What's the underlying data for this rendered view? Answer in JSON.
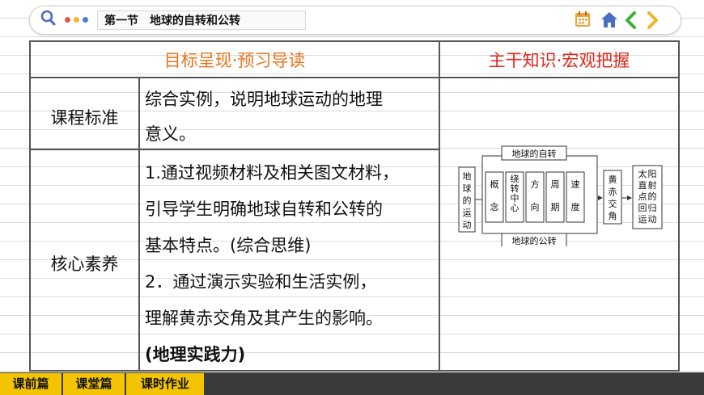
{
  "header": {
    "section_title": "第一节　地球的自转和公转",
    "dot_colors": [
      "#e05a47",
      "#f2b732",
      "#4a7fd6"
    ],
    "icons": [
      "calendar-icon",
      "home-icon",
      "back-arrow-icon",
      "forward-arrow-icon"
    ]
  },
  "table": {
    "left_header": "目标呈现·预习导读",
    "right_header": "主干知识·宏观把握",
    "row1_label": "课程标准",
    "row1_lines": [
      "综合实例，说明地球运动的地理",
      "意义。"
    ],
    "row2_label": "核心素养",
    "row2_lines": [
      "1.通过视频材料及相关图文材料，",
      "引导学生明确地球自转和公转的",
      "基本特点。(综合思维)",
      "2．通过演示实验和生活实例，",
      "理解黄赤交角及其产生的影响。",
      "(地理实践力)"
    ]
  },
  "diagram": {
    "left_box": "地球的运动",
    "top_box": "地球的自转",
    "bottom_box": "地球的公转",
    "middle_boxes": [
      "概念",
      "绕转中心",
      "方向",
      "周期",
      "速度"
    ],
    "box_yellow": "黄赤交角",
    "box_sun": "太阳直射点的回归运动"
  },
  "nav": {
    "items": [
      "课前篇",
      "课堂篇",
      "课时作业"
    ]
  },
  "colors": {
    "header_orange": "#e8741c",
    "header_red": "#e0261a",
    "nav_yellow": "#f5c400"
  }
}
